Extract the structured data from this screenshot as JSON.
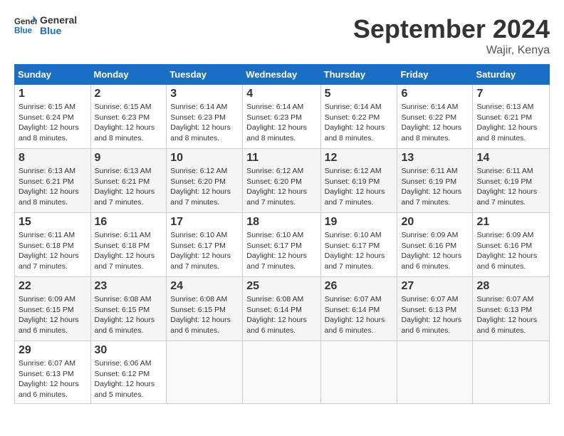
{
  "header": {
    "logo_general": "General",
    "logo_blue": "Blue",
    "month_title": "September 2024",
    "location": "Wajir, Kenya"
  },
  "days_of_week": [
    "Sunday",
    "Monday",
    "Tuesday",
    "Wednesday",
    "Thursday",
    "Friday",
    "Saturday"
  ],
  "weeks": [
    [
      {
        "day": "1",
        "sunrise": "6:15 AM",
        "sunset": "6:24 PM",
        "daylight": "12 hours and 8 minutes."
      },
      {
        "day": "2",
        "sunrise": "6:15 AM",
        "sunset": "6:23 PM",
        "daylight": "12 hours and 8 minutes."
      },
      {
        "day": "3",
        "sunrise": "6:14 AM",
        "sunset": "6:23 PM",
        "daylight": "12 hours and 8 minutes."
      },
      {
        "day": "4",
        "sunrise": "6:14 AM",
        "sunset": "6:23 PM",
        "daylight": "12 hours and 8 minutes."
      },
      {
        "day": "5",
        "sunrise": "6:14 AM",
        "sunset": "6:22 PM",
        "daylight": "12 hours and 8 minutes."
      },
      {
        "day": "6",
        "sunrise": "6:14 AM",
        "sunset": "6:22 PM",
        "daylight": "12 hours and 8 minutes."
      },
      {
        "day": "7",
        "sunrise": "6:13 AM",
        "sunset": "6:21 PM",
        "daylight": "12 hours and 8 minutes."
      }
    ],
    [
      {
        "day": "8",
        "sunrise": "6:13 AM",
        "sunset": "6:21 PM",
        "daylight": "12 hours and 8 minutes."
      },
      {
        "day": "9",
        "sunrise": "6:13 AM",
        "sunset": "6:21 PM",
        "daylight": "12 hours and 7 minutes."
      },
      {
        "day": "10",
        "sunrise": "6:12 AM",
        "sunset": "6:20 PM",
        "daylight": "12 hours and 7 minutes."
      },
      {
        "day": "11",
        "sunrise": "6:12 AM",
        "sunset": "6:20 PM",
        "daylight": "12 hours and 7 minutes."
      },
      {
        "day": "12",
        "sunrise": "6:12 AM",
        "sunset": "6:19 PM",
        "daylight": "12 hours and 7 minutes."
      },
      {
        "day": "13",
        "sunrise": "6:11 AM",
        "sunset": "6:19 PM",
        "daylight": "12 hours and 7 minutes."
      },
      {
        "day": "14",
        "sunrise": "6:11 AM",
        "sunset": "6:19 PM",
        "daylight": "12 hours and 7 minutes."
      }
    ],
    [
      {
        "day": "15",
        "sunrise": "6:11 AM",
        "sunset": "6:18 PM",
        "daylight": "12 hours and 7 minutes."
      },
      {
        "day": "16",
        "sunrise": "6:11 AM",
        "sunset": "6:18 PM",
        "daylight": "12 hours and 7 minutes."
      },
      {
        "day": "17",
        "sunrise": "6:10 AM",
        "sunset": "6:17 PM",
        "daylight": "12 hours and 7 minutes."
      },
      {
        "day": "18",
        "sunrise": "6:10 AM",
        "sunset": "6:17 PM",
        "daylight": "12 hours and 7 minutes."
      },
      {
        "day": "19",
        "sunrise": "6:10 AM",
        "sunset": "6:17 PM",
        "daylight": "12 hours and 7 minutes."
      },
      {
        "day": "20",
        "sunrise": "6:09 AM",
        "sunset": "6:16 PM",
        "daylight": "12 hours and 6 minutes."
      },
      {
        "day": "21",
        "sunrise": "6:09 AM",
        "sunset": "6:16 PM",
        "daylight": "12 hours and 6 minutes."
      }
    ],
    [
      {
        "day": "22",
        "sunrise": "6:09 AM",
        "sunset": "6:15 PM",
        "daylight": "12 hours and 6 minutes."
      },
      {
        "day": "23",
        "sunrise": "6:08 AM",
        "sunset": "6:15 PM",
        "daylight": "12 hours and 6 minutes."
      },
      {
        "day": "24",
        "sunrise": "6:08 AM",
        "sunset": "6:15 PM",
        "daylight": "12 hours and 6 minutes."
      },
      {
        "day": "25",
        "sunrise": "6:08 AM",
        "sunset": "6:14 PM",
        "daylight": "12 hours and 6 minutes."
      },
      {
        "day": "26",
        "sunrise": "6:07 AM",
        "sunset": "6:14 PM",
        "daylight": "12 hours and 6 minutes."
      },
      {
        "day": "27",
        "sunrise": "6:07 AM",
        "sunset": "6:13 PM",
        "daylight": "12 hours and 6 minutes."
      },
      {
        "day": "28",
        "sunrise": "6:07 AM",
        "sunset": "6:13 PM",
        "daylight": "12 hours and 6 minutes."
      }
    ],
    [
      {
        "day": "29",
        "sunrise": "6:07 AM",
        "sunset": "6:13 PM",
        "daylight": "12 hours and 6 minutes."
      },
      {
        "day": "30",
        "sunrise": "6:06 AM",
        "sunset": "6:12 PM",
        "daylight": "12 hours and 5 minutes."
      },
      null,
      null,
      null,
      null,
      null
    ]
  ],
  "labels": {
    "sunrise": "Sunrise:",
    "sunset": "Sunset:",
    "daylight": "Daylight:"
  }
}
